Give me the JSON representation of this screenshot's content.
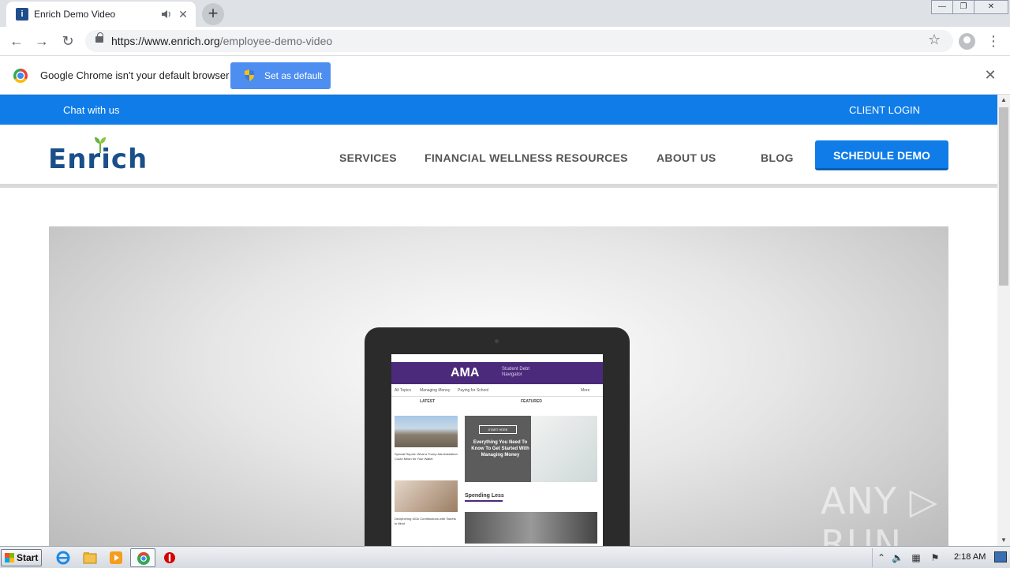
{
  "browser": {
    "tab_title": "Enrich Demo Video",
    "tab_favicon": "i",
    "new_tab_label": "+",
    "url_host": "https://www.enrich.org",
    "url_path": "/employee-demo-video",
    "window_buttons": {
      "minimize": "—",
      "restore": "❐",
      "close": "✕"
    }
  },
  "infobar": {
    "message": "Google Chrome isn't your default browser",
    "button_label": "Set as default",
    "close": "✕"
  },
  "site": {
    "topbar": {
      "chat": "Chat with us",
      "login": "CLIENT LOGIN"
    },
    "logo_text": "Enrich",
    "nav": {
      "services": "SERVICES",
      "resources": "FINANCIAL WELLNESS RESOURCES",
      "about": "ABOUT US",
      "blog": "BLOG",
      "cta": "SCHEDULE DEMO"
    },
    "video": {
      "screen_brand": "AMA",
      "screen_sub": "Student Debt Navigator",
      "screen_nav": [
        "All Topics",
        "Managing Money",
        "Paying for School",
        "More"
      ],
      "screen_col_latest": "LATEST",
      "screen_col_featured": "FEATURED",
      "feature_button": "START HERE",
      "feature_text": "Everything You Need To Know To Get Started With Managing Money",
      "article1": "Special Report: What a Trump Administration Could Mean for Your Wallet",
      "article2": "Deciphering 401k Contributions with Tweets in Mind",
      "spending": "Spending Less",
      "watermark": "ANY ▷ RUN"
    }
  },
  "taskbar": {
    "start": "Start",
    "clock": "2:18 AM"
  },
  "colors": {
    "brand_blue": "#0f7ce8",
    "logo_blue": "#1b4f8a",
    "infobar_button": "#4d8ef0",
    "ama_purple": "#4b2a7b"
  }
}
